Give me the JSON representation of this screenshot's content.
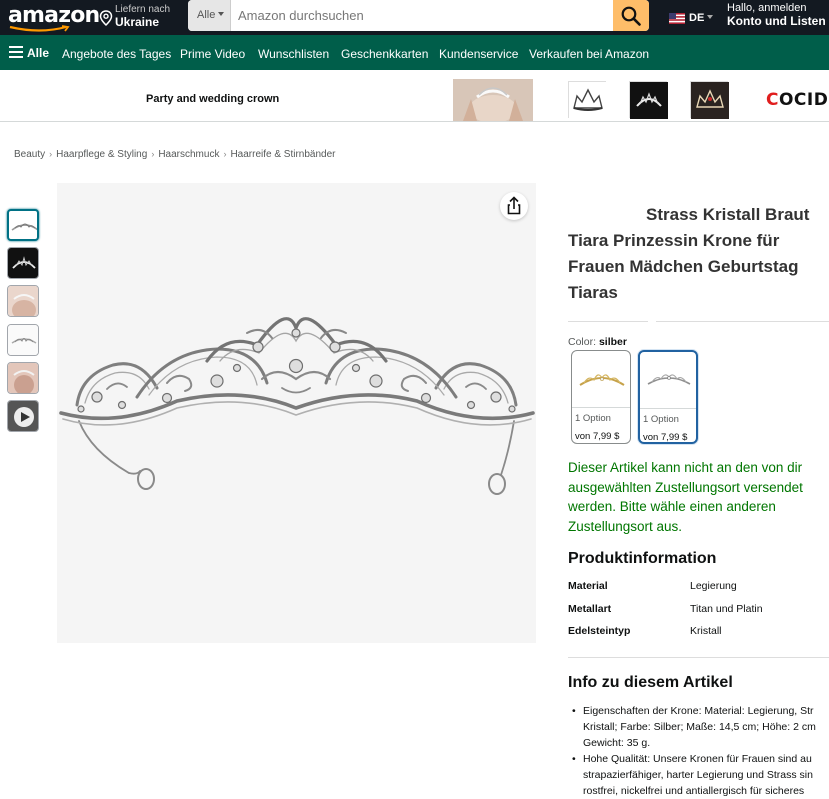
{
  "header": {
    "logo_text": "amazon",
    "deliver_line1": "Liefern nach",
    "deliver_line2": "Ukraine",
    "search_category": "Alle",
    "search_placeholder": "Amazon durchsuchen",
    "language": "DE",
    "account_line1": "Hallo, anmelden",
    "account_line2": "Konto und Listen"
  },
  "subnav": {
    "all_label": "Alle",
    "items": [
      "Angebote des Tages",
      "Prime Video",
      "Wunschlisten",
      "Geschenkkarten",
      "Kundenservice",
      "Verkaufen bei Amazon"
    ]
  },
  "ad": {
    "tagline": "Party and wedding crown",
    "brand_c": "C",
    "brand_rest": "OCID"
  },
  "breadcrumb": [
    "Beauty",
    "Haarpflege & Styling",
    "Haarschmuck",
    "Haarreife & Stirnbänder"
  ],
  "product": {
    "title_line1": "Strass Kristall Braut",
    "title_rest": "Tiara Prinzessin Krone für Frauen Mädchen Geburtstag Tiaras",
    "color_label": "Color:",
    "color_value": "silber",
    "swatches": [
      {
        "option": "1 Option",
        "price": "von 7,99 $"
      },
      {
        "option": "1 Option",
        "price": "von 7,99 $"
      }
    ],
    "availability": "Dieser Artikel kann nicht an den von dir ausgewählten Zustellungsort versendet werden. Bitte wähle einen anderen Zustellungsort aus.",
    "product_info_heading": "Produktinformation",
    "specs": [
      {
        "key": "Material",
        "value": "Legierung"
      },
      {
        "key": "Metallart",
        "value": "Titan und Platin"
      },
      {
        "key": "Edelsteintyp",
        "value": "Kristall"
      }
    ],
    "about_heading": "Info zu diesem Artikel",
    "bullets": [
      "Eigenschaften der Krone: Material: Legierung, Str\nKristall; Farbe: Silber; Maße: 14,5 cm; Höhe: 2 cm\nGewicht: 35 g.",
      "Hohe Qualität: Unsere Kronen für Frauen sind au\nstrapazierfähiger, harter Legierung und Strass sin\nrostfrei, nickelfrei und antiallergisch für sicheres"
    ]
  },
  "colors": {
    "nav_dark": "#131921",
    "nav_green": "#005e4a",
    "search_button": "#febd69",
    "availability_green": "#007600",
    "selected_border": "#2162a1"
  }
}
